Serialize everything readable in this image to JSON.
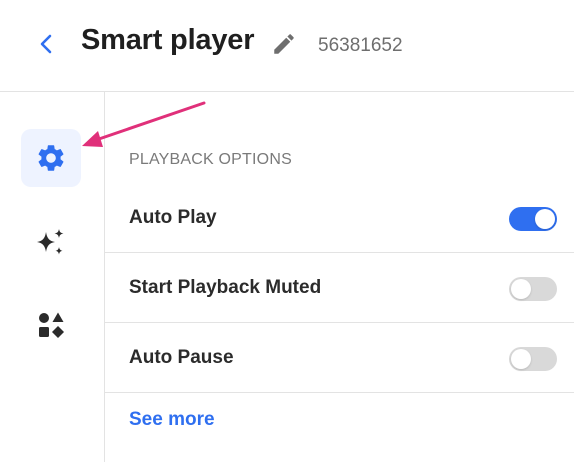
{
  "header": {
    "title": "Smart player",
    "player_id": "56381652",
    "back_icon": "chevron-left-icon",
    "edit_icon": "pencil-icon"
  },
  "rail": {
    "items": [
      {
        "id": "settings",
        "icon": "gear-icon",
        "active": true
      },
      {
        "id": "ai",
        "icon": "sparkles-icon",
        "active": false
      },
      {
        "id": "apps",
        "icon": "shapes-icon",
        "active": false
      }
    ]
  },
  "main": {
    "section_heading": "PLAYBACK OPTIONS",
    "options": [
      {
        "label": "Auto Play",
        "enabled": true
      },
      {
        "label": "Start Playback Muted",
        "enabled": false
      },
      {
        "label": "Auto Pause",
        "enabled": false
      }
    ],
    "see_more": "See more"
  },
  "colors": {
    "accent": "#2f6ff0",
    "rail_active_bg": "#eef3ff",
    "toggle_off": "#d9d9d9",
    "annotation_arrow": "#e0307a"
  }
}
